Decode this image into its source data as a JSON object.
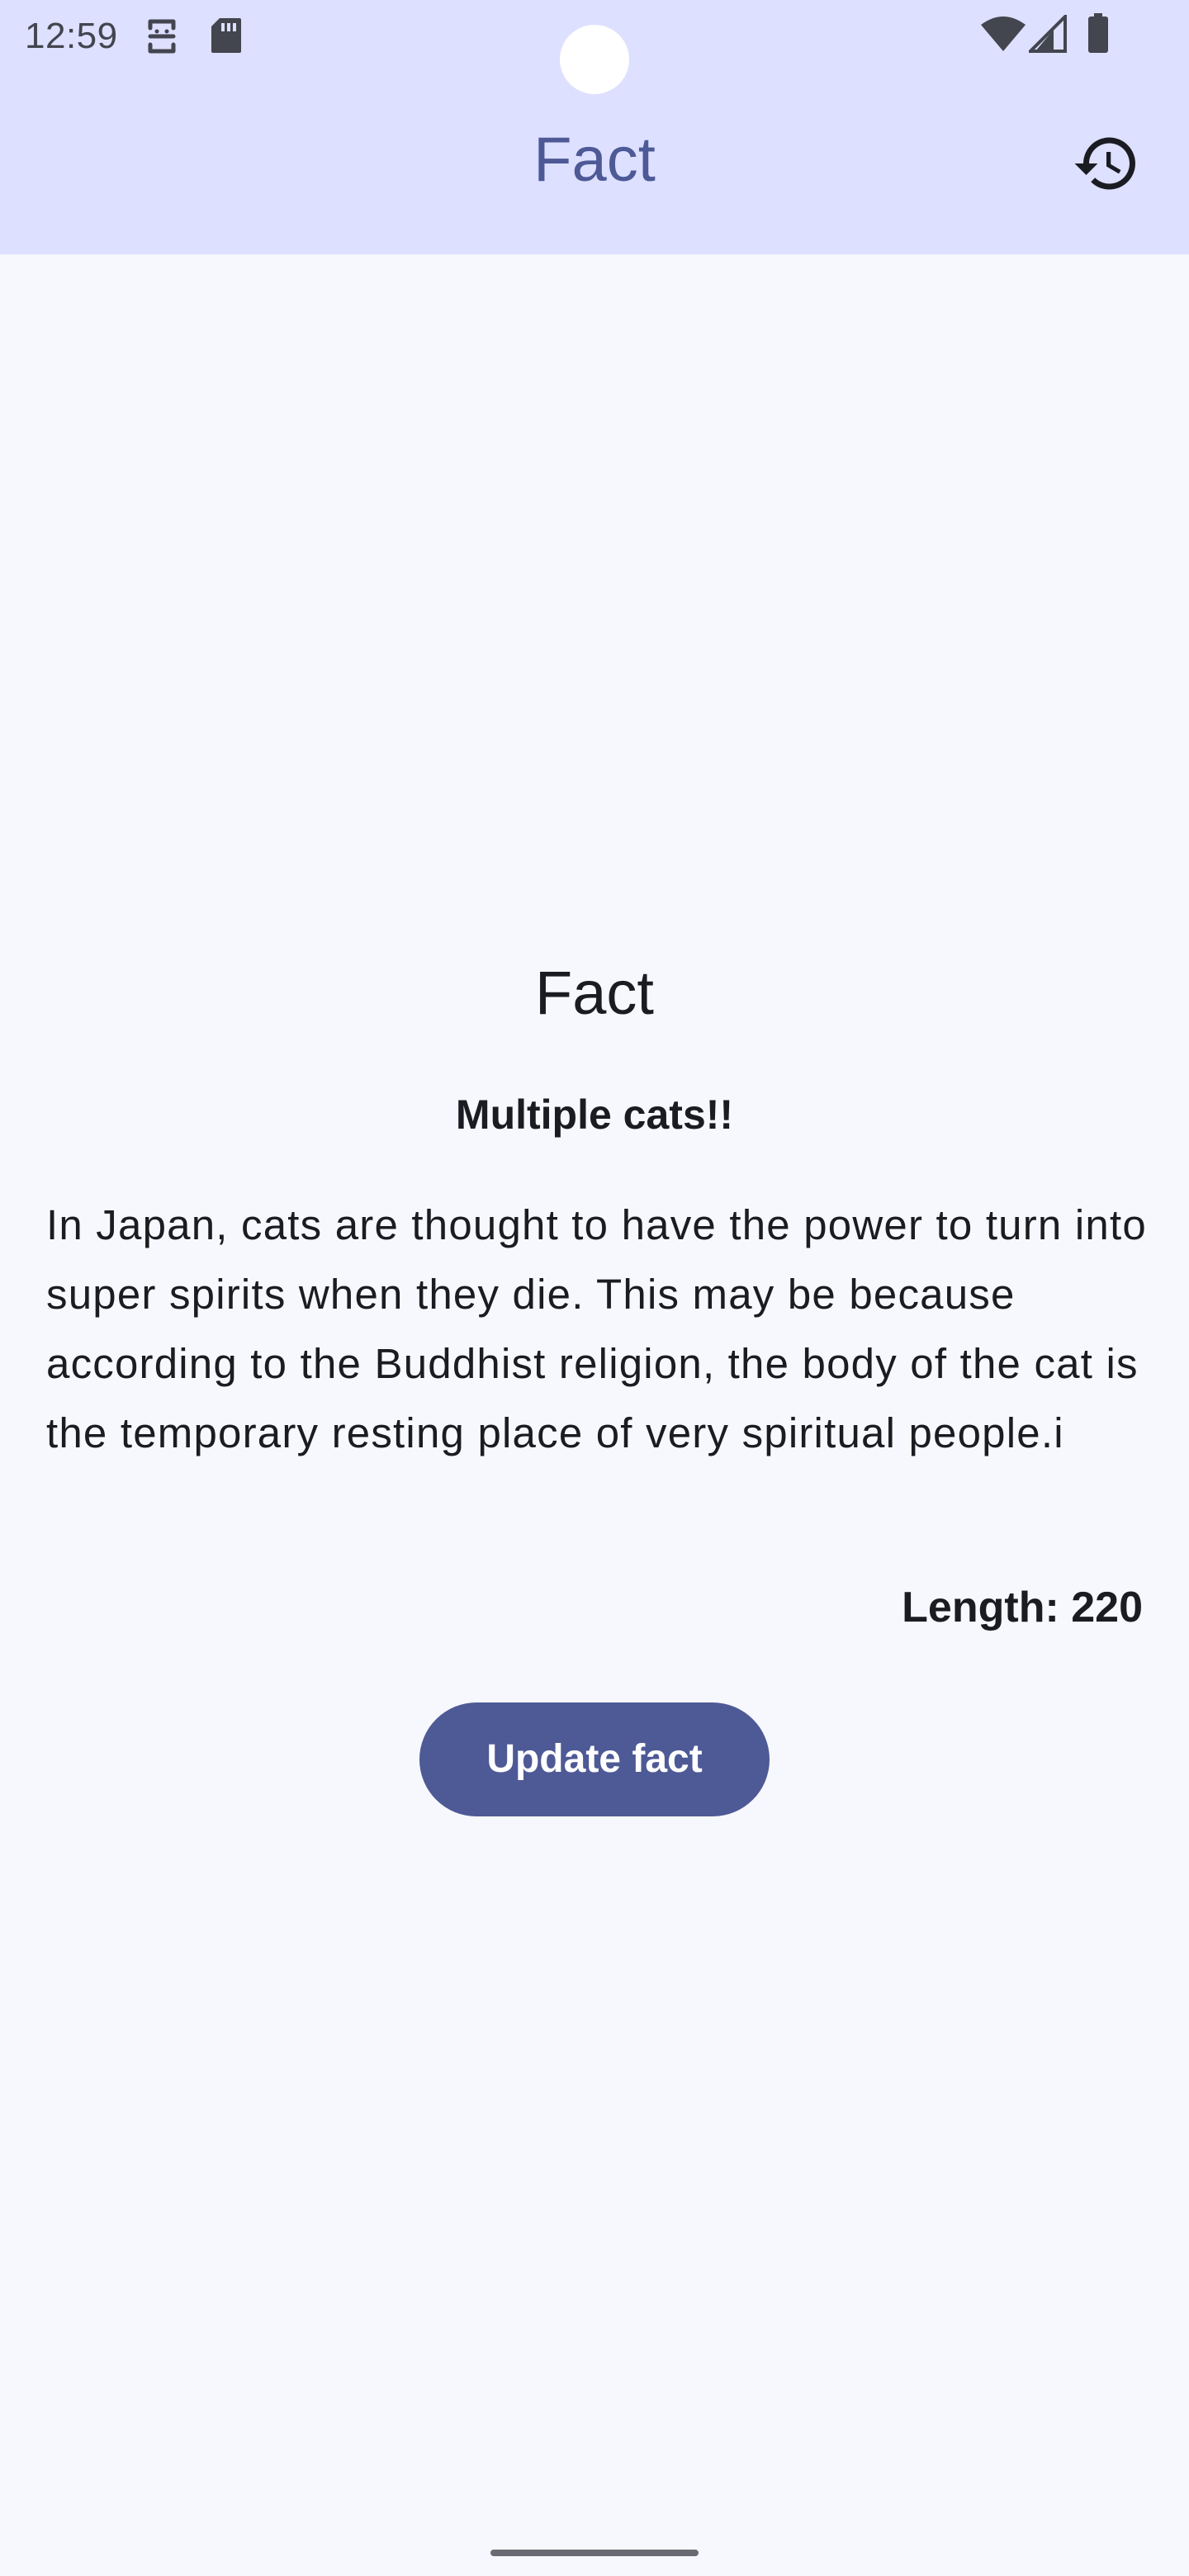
{
  "status_bar": {
    "time": "12:59",
    "icons": [
      "sync-icon",
      "sd-card-icon",
      "wifi-icon",
      "signal-icon",
      "battery-icon"
    ]
  },
  "app_bar": {
    "title": "Fact",
    "action_icon": "history-icon"
  },
  "main": {
    "heading": "Fact",
    "subtitle": "Multiple cats!!",
    "text": "In Japan, cats are thought to have the power to turn into super spirits when they die. This may be because according to the Buddhist religion, the body of the cat is the temporary resting place of very spiritual people.i",
    "length_label": "Length: 220",
    "update_button_label": "Update fact"
  },
  "colors": {
    "app_bar_bg": "#dde0ff",
    "primary": "#4e5a96",
    "background": "#f7f8fd",
    "on_surface": "#1b1c22"
  }
}
